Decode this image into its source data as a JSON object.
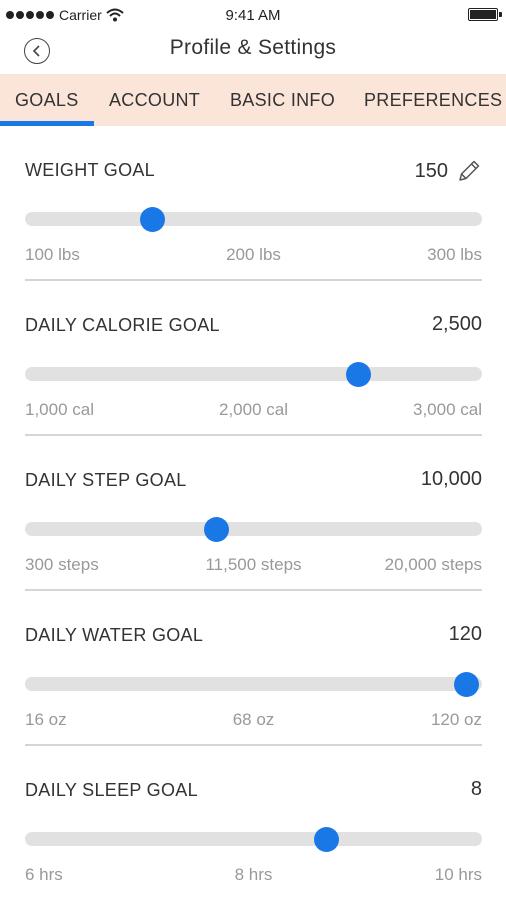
{
  "status_bar": {
    "carrier": "Carrier",
    "time": "9:41 AM"
  },
  "nav": {
    "title": "Profile & Settings",
    "back_icon": "chevron-left-circle-icon"
  },
  "tabs": [
    {
      "label": "GOALS",
      "active": true
    },
    {
      "label": "ACCOUNT",
      "active": false
    },
    {
      "label": "BASIC INFO",
      "active": false
    },
    {
      "label": "PREFERENCES",
      "active": false
    }
  ],
  "colors": {
    "accent": "#1a78e6",
    "tab_bar_bg": "#fbe4d8",
    "track": "#e1e1e1",
    "muted_text": "#999999"
  },
  "goals": [
    {
      "label": "WEIGHT GOAL",
      "value": "150",
      "editable": true,
      "edit_icon": "pencil-icon",
      "fraction": 0.28,
      "min": "100 lbs",
      "mid": "200 lbs",
      "max": "300 lbs"
    },
    {
      "label": "DAILY CALORIE GOAL",
      "value": "2,500",
      "editable": false,
      "fraction": 0.73,
      "min": "1,000 cal",
      "mid": "2,000 cal",
      "max": "3,000 cal"
    },
    {
      "label": "DAILY STEP GOAL",
      "value": "10,000",
      "editable": false,
      "fraction": 0.42,
      "min": "300 steps",
      "mid": "11,500 steps",
      "max": "20,000 steps"
    },
    {
      "label": "DAILY WATER GOAL",
      "value": "120",
      "editable": false,
      "fraction": 0.965,
      "min": "16 oz",
      "mid": "68 oz",
      "max": "120 oz"
    },
    {
      "label": "DAILY SLEEP GOAL",
      "value": "8",
      "editable": false,
      "fraction": 0.66,
      "min": "6 hrs",
      "mid": "8 hrs",
      "max": "10 hrs"
    }
  ]
}
